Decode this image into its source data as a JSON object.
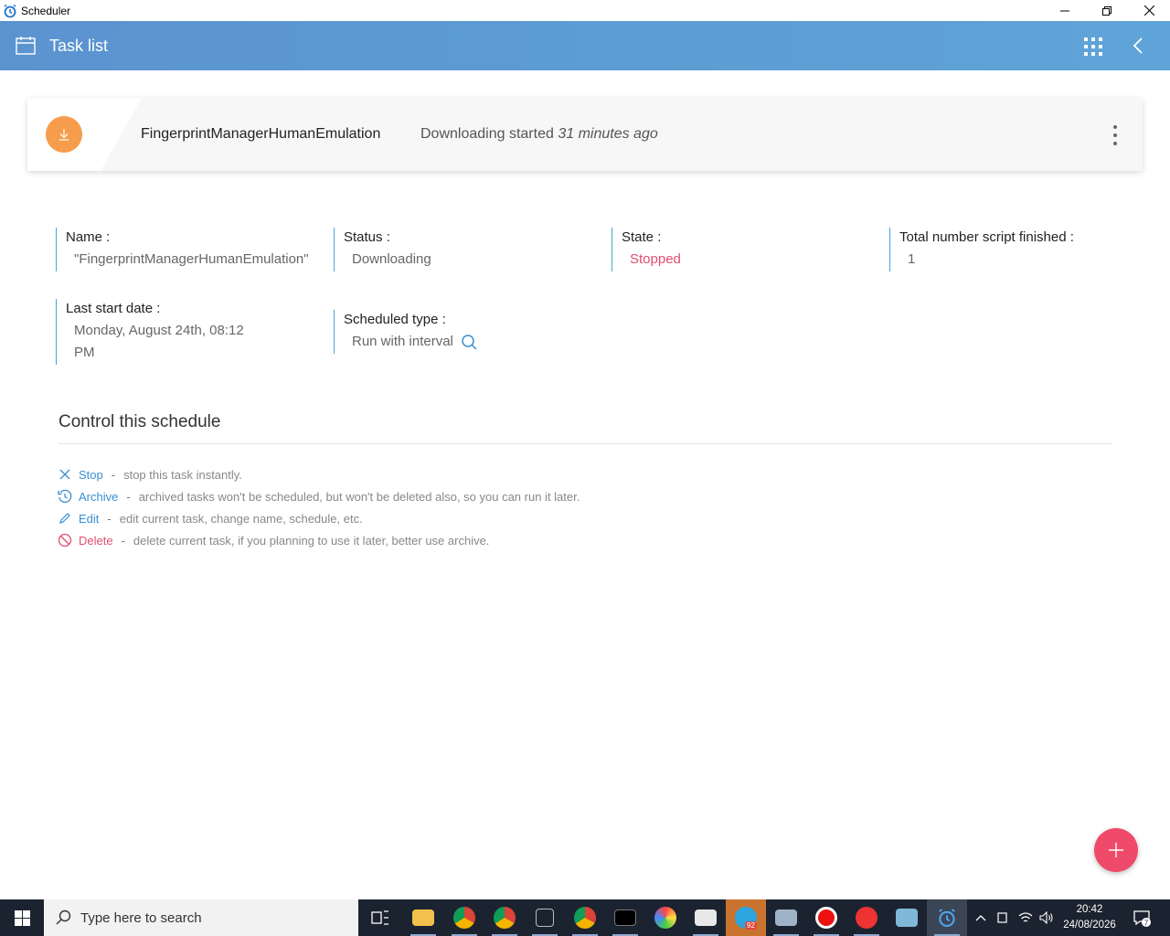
{
  "window": {
    "title": "Scheduler"
  },
  "header": {
    "title": "Task list"
  },
  "task_card": {
    "name": "FingerprintManagerHumanEmulation",
    "status_prefix": "Downloading started",
    "status_time": "31 minutes ago"
  },
  "details": {
    "name_label": "Name :",
    "name_value": "\"FingerprintManagerHumanEmulation\"",
    "status_label": "Status :",
    "status_value": "Downloading",
    "state_label": "State :",
    "state_value": "Stopped",
    "total_label": "Total number script finished :",
    "total_value": "1",
    "last_start_label": "Last start date :",
    "last_start_value_line1": "Monday, August 24th, 08:12",
    "last_start_value_line2": "PM",
    "scheduled_label": "Scheduled type :",
    "scheduled_value": "Run with interval"
  },
  "control": {
    "title": "Control this schedule",
    "actions": [
      {
        "label": "Stop",
        "desc": "stop this task instantly.",
        "icon": "close-icon"
      },
      {
        "label": "Archive",
        "desc": "archived tasks won't be scheduled, but won't be deleted also, so you can run it later.",
        "icon": "history-icon"
      },
      {
        "label": "Edit",
        "desc": "edit current task, change name, schedule, etc.",
        "icon": "pencil-icon"
      },
      {
        "label": "Delete",
        "desc": "delete current task, if you planning to use it later, better use archive.",
        "icon": "ban-icon"
      }
    ],
    "separator": "-"
  },
  "taskbar": {
    "search_placeholder": "Type here to search",
    "time": "20:42",
    "date": "24/08/2026",
    "telegram_badge": "92",
    "notification_count": "7"
  },
  "colors": {
    "header_start": "#5b93cf",
    "header_end": "#5fa4d8",
    "accent_blue": "#3a8fd1",
    "danger": "#e44d6c",
    "download_orange": "#f59d4c",
    "fab": "#ef4a6a"
  }
}
